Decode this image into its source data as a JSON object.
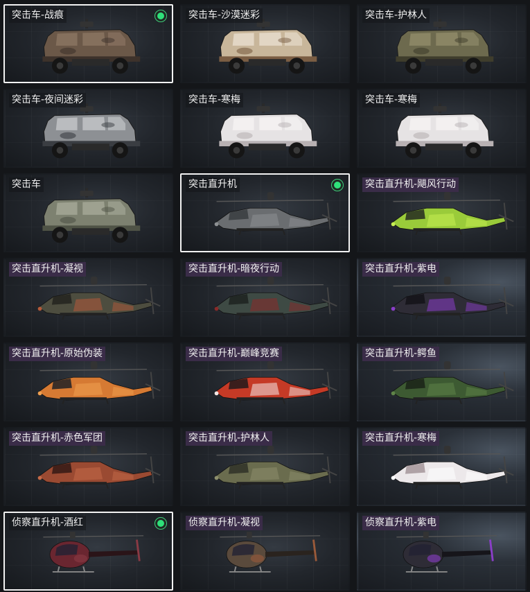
{
  "items": [
    {
      "label": "突击车-战痕",
      "type": "car",
      "selected": true,
      "owned": true,
      "tag": "plain",
      "colors": [
        "#6b5848",
        "#3d322b",
        "#8a7462"
      ]
    },
    {
      "label": "突击车-沙漠迷彩",
      "type": "car",
      "selected": false,
      "owned": false,
      "tag": "plain",
      "colors": [
        "#c8b69a",
        "#7a5d43",
        "#e6dccb"
      ]
    },
    {
      "label": "突击车-护林人",
      "type": "car",
      "selected": false,
      "owned": false,
      "tag": "plain",
      "colors": [
        "#6d6a4e",
        "#3f3d2c",
        "#8f8a69"
      ]
    },
    {
      "label": "突击车-夜间迷彩",
      "type": "car",
      "selected": false,
      "owned": false,
      "tag": "plain",
      "colors": [
        "#8d9094",
        "#3a3d42",
        "#c2c4c7"
      ]
    },
    {
      "label": "突击车-寒梅",
      "type": "car",
      "selected": false,
      "owned": false,
      "tag": "plain",
      "colors": [
        "#e6e3e4",
        "#b8b1b3",
        "#f4f2f2"
      ]
    },
    {
      "label": "突击车-寒梅",
      "type": "car",
      "selected": false,
      "owned": false,
      "tag": "plain",
      "colors": [
        "#e6e3e4",
        "#b8b1b3",
        "#f4f2f2"
      ]
    },
    {
      "label": "突击车",
      "type": "car",
      "selected": false,
      "owned": false,
      "tag": "plain",
      "colors": [
        "#7d8170",
        "#4f5346",
        "#a3a795"
      ]
    },
    {
      "label": "突击直升机",
      "type": "heli",
      "selected": true,
      "owned": true,
      "tag": "plain",
      "colors": [
        "#6a6d70",
        "#3c3f42",
        "#8d9093"
      ]
    },
    {
      "label": "突击直升机-飓风行动",
      "type": "heli",
      "selected": false,
      "owned": false,
      "tag": "purple",
      "colors": [
        "#9acb3a",
        "#2b3322",
        "#c6ee52"
      ]
    },
    {
      "label": "突击直升机-凝视",
      "type": "heli",
      "selected": false,
      "owned": false,
      "tag": "purple",
      "colors": [
        "#4d4d3f",
        "#262620",
        "#b45a3a"
      ]
    },
    {
      "label": "突击直升机-暗夜行动",
      "type": "heli",
      "selected": false,
      "owned": false,
      "tag": "purple",
      "colors": [
        "#3e4a44",
        "#1f2522",
        "#8a2a2a"
      ]
    },
    {
      "label": "突击直升机-紫电",
      "type": "heli",
      "selected": false,
      "owned": false,
      "tag": "purple",
      "colors": [
        "#2e2c36",
        "#15141a",
        "#8a3ec8"
      ]
    },
    {
      "label": "突击直升机-原始伪装",
      "type": "heli",
      "selected": false,
      "owned": false,
      "tag": "purple",
      "colors": [
        "#d67a33",
        "#2a2626",
        "#f0a050"
      ]
    },
    {
      "label": "突击直升机-巅峰竞赛",
      "type": "heli",
      "selected": false,
      "owned": false,
      "tag": "purple",
      "colors": [
        "#c53a26",
        "#2a1c1c",
        "#f2e6e4"
      ]
    },
    {
      "label": "突击直升机-鳄鱼",
      "type": "heli",
      "selected": false,
      "owned": false,
      "tag": "purple",
      "colors": [
        "#3d5a32",
        "#1c2618",
        "#5f8448"
      ]
    },
    {
      "label": "突击直升机-赤色军团",
      "type": "heli",
      "selected": false,
      "owned": false,
      "tag": "purple",
      "colors": [
        "#9a4a32",
        "#3a1c16",
        "#c46a48"
      ]
    },
    {
      "label": "突击直升机-护林人",
      "type": "heli",
      "selected": false,
      "owned": false,
      "tag": "purple",
      "colors": [
        "#6a6c4e",
        "#33352a",
        "#8c8e6c"
      ]
    },
    {
      "label": "突击直升机-寒梅",
      "type": "heli",
      "selected": false,
      "owned": false,
      "tag": "purple",
      "colors": [
        "#ece8ea",
        "#a89a9e",
        "#ffffff"
      ]
    },
    {
      "label": "侦察直升机-酒红",
      "type": "scout",
      "selected": true,
      "owned": true,
      "tag": "plain",
      "colors": [
        "#6a2630",
        "#2a1418",
        "#8a3a44"
      ]
    },
    {
      "label": "侦察直升机-凝视",
      "type": "scout",
      "selected": false,
      "owned": false,
      "tag": "purple",
      "colors": [
        "#5a4a3c",
        "#2a231e",
        "#9a5a3a"
      ]
    },
    {
      "label": "侦察直升机-紫电",
      "type": "scout",
      "selected": false,
      "owned": false,
      "tag": "purple",
      "colors": [
        "#2e2c36",
        "#16151a",
        "#8a3ec8"
      ]
    }
  ]
}
